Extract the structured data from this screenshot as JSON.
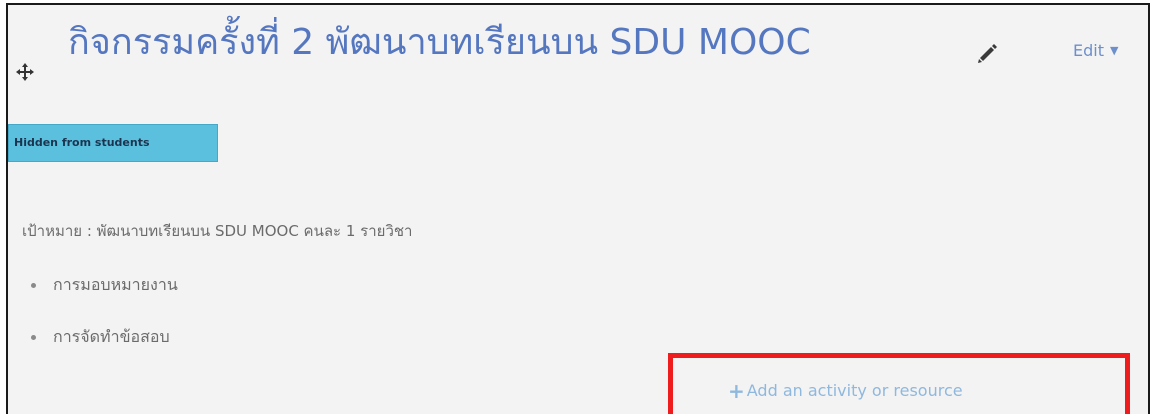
{
  "section": {
    "title": "กิจกรรมครั้งที่ 2 พัฒนาบทเรียนบน SDU MOOC",
    "edit_label": "Edit",
    "badge": "Hidden from students",
    "goal": "เป้าหมาย : พัฒนาบทเรียนบน SDU MOOC คนละ 1 รายวิชา",
    "bullets": [
      "การมอบหมายงาน",
      "การจัดทำข้อสอบ"
    ],
    "add_activity_label": "Add an activity or resource"
  },
  "icons": {
    "move": "move-icon",
    "edit_title": "pencil-icon",
    "edit_caret": "caret-down-icon",
    "add": "plus-icon"
  },
  "colors": {
    "title": "#5577c0",
    "badge_bg": "#5bc0de",
    "link": "#8fb8de",
    "highlight": "#ee1c1c"
  }
}
